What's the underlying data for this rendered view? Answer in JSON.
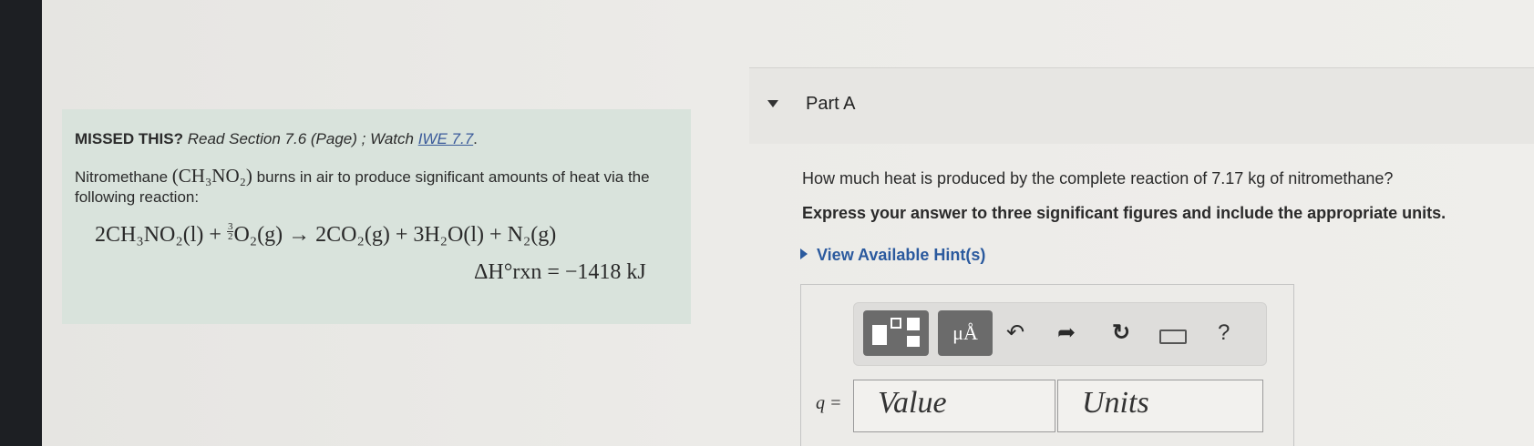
{
  "missed": {
    "prefix": "MISSED THIS?",
    "read": "Read Section 7.6 (Page) ; Watch",
    "link": "IWE 7.7",
    "suffix": "."
  },
  "problem": {
    "text_before": "Nitromethane",
    "formula": "(CH₃NO₂)",
    "text_after": "burns in air to produce significant amounts of heat via the following reaction:"
  },
  "equation": {
    "reactant1": "2CH₃NO₂(l) +",
    "frac_num": "3",
    "frac_den": "2",
    "reactant2": "O₂(g) → 2CO₂(g) + 3H₂O(l) + N₂(g)"
  },
  "enthalpy": {
    "text": "ΔH°rxn = −1418 kJ"
  },
  "partA": {
    "title": "Part A",
    "question": "How much heat is produced by the complete reaction of 7.17 kg of nitromethane?",
    "instruction": "Express your answer to three significant figures and include the appropriate units.",
    "hint": "View Available Hint(s)"
  },
  "toolbar": {
    "units_label": "μÅ",
    "undo_glyph": "↶",
    "redo_glyph": "➦",
    "reset_glyph": "↻",
    "help_label": "?"
  },
  "answer": {
    "q_label": "q =",
    "value_placeholder": "Value",
    "units_placeholder": "Units"
  },
  "icons": [
    "caret-down-icon",
    "templates-icon",
    "undo-icon",
    "redo-icon",
    "reset-icon",
    "keyboard-icon",
    "help-icon"
  ]
}
